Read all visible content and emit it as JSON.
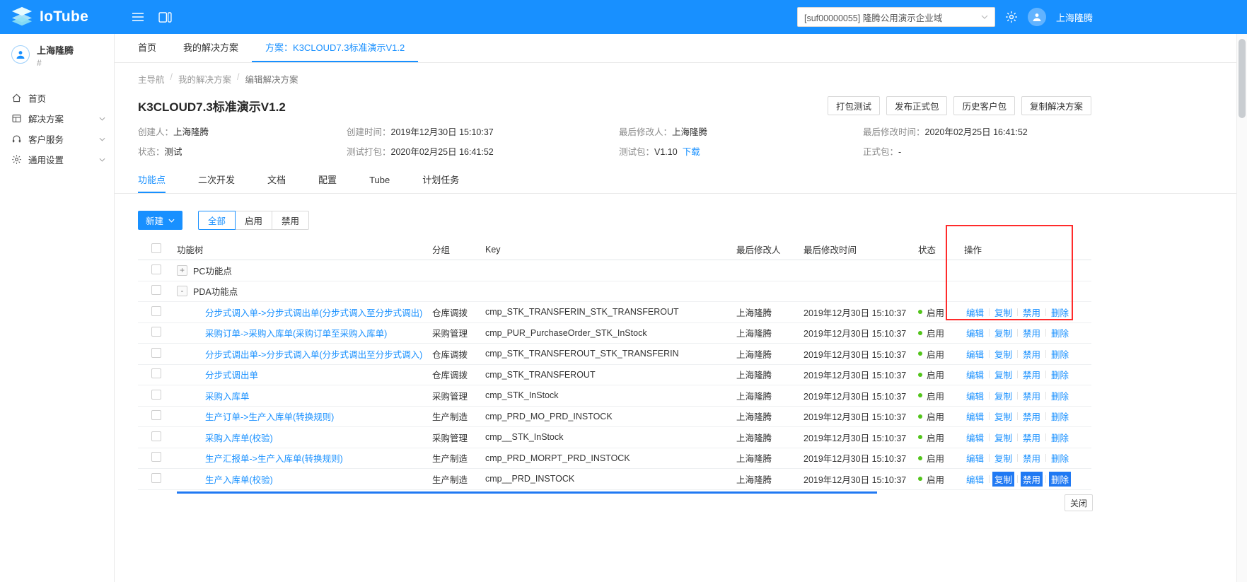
{
  "colors": {
    "accent": "#1890ff",
    "topbar": "#1890ff",
    "status_green": "#52c41a",
    "annotation_red": "#ff2b2b",
    "selection_blue": "#2079f3"
  },
  "header": {
    "logo_io": "Io",
    "logo_tube": "Tube",
    "domain_select_value": "[suf00000055] 隆腾公用演示企业域",
    "user_name": "上海隆腾"
  },
  "sidebar": {
    "user_name": "上海隆腾",
    "user_sub": "#",
    "items": [
      {
        "id": "home",
        "label": "首页",
        "icon": "home-icon",
        "expandable": false
      },
      {
        "id": "solutions",
        "label": "解决方案",
        "icon": "solutions-icon",
        "expandable": true
      },
      {
        "id": "customer-service",
        "label": "客户服务",
        "icon": "customer-service-icon",
        "expandable": true
      },
      {
        "id": "general-settings",
        "label": "通用设置",
        "icon": "settings-icon",
        "expandable": true
      }
    ]
  },
  "nav_tabs": [
    {
      "id": "home",
      "label": "首页",
      "active": false
    },
    {
      "id": "my-solutions",
      "label": "我的解决方案",
      "active": false
    },
    {
      "id": "solution",
      "label": "方案：K3CLOUD7.3标准演示V1.2",
      "active": true
    }
  ],
  "breadcrumb": [
    "主导航",
    "我的解决方案",
    "编辑解决方案"
  ],
  "page": {
    "title": "K3CLOUD7.3标准演示V1.2",
    "action_buttons": [
      {
        "id": "package-test",
        "label": "打包测试"
      },
      {
        "id": "publish-release",
        "label": "发布正式包"
      },
      {
        "id": "history-customer-packages",
        "label": "历史客户包"
      },
      {
        "id": "copy-solution",
        "label": "复制解决方案"
      }
    ],
    "meta": [
      [
        {
          "label": "创建人：",
          "value": "上海隆腾"
        },
        {
          "label": "创建时间：",
          "value": "2019年12月30日 15:10:37"
        },
        {
          "label": "最后修改人：",
          "value": "上海隆腾"
        },
        {
          "label": "最后修改时间：",
          "value": "2020年02月25日 16:41:52"
        }
      ],
      [
        {
          "label": "状态：",
          "value": "测试"
        },
        {
          "label": "测试打包：",
          "value": "2020年02月25日 16:41:52"
        },
        {
          "label": "测试包：",
          "value": "V1.10",
          "link": "下载"
        },
        {
          "label": "正式包：",
          "value": "-"
        }
      ]
    ]
  },
  "content_tabs": [
    {
      "id": "features",
      "label": "功能点",
      "active": true
    },
    {
      "id": "secondary-development",
      "label": "二次开发",
      "active": false
    },
    {
      "id": "documents",
      "label": "文档",
      "active": false
    },
    {
      "id": "config",
      "label": "配置",
      "active": false
    },
    {
      "id": "tube",
      "label": "Tube",
      "active": false
    },
    {
      "id": "scheduled-tasks",
      "label": "计划任务",
      "active": false
    }
  ],
  "toolbar": {
    "new_button": "新建",
    "filter_buttons": [
      {
        "id": "all",
        "label": "全部",
        "active": true
      },
      {
        "id": "enable",
        "label": "启用",
        "active": false
      },
      {
        "id": "disable",
        "label": "禁用",
        "active": false
      }
    ]
  },
  "table": {
    "columns": [
      "",
      "功能树",
      "分组",
      "Key",
      "最后修改人",
      "最后修改时间",
      "状态",
      "操作"
    ],
    "action_labels": [
      "编辑",
      "复制",
      "禁用",
      "删除"
    ],
    "rows": [
      {
        "type": "group",
        "expander": "+",
        "name": "PC功能点"
      },
      {
        "type": "group",
        "expander": "-",
        "name": "PDA功能点"
      },
      {
        "type": "item",
        "name": "分步式调入单->分步式调出单(分步式调入至分步式调出)",
        "group": "仓库调拨",
        "key": "cmp_STK_TRANSFERIN_STK_TRANSFEROUT",
        "modifier": "上海隆腾",
        "modified": "2019年12月30日 15:10:37",
        "status": "启用"
      },
      {
        "type": "item",
        "name": "采购订单->采购入库单(采购订单至采购入库单)",
        "group": "采购管理",
        "key": "cmp_PUR_PurchaseOrder_STK_InStock",
        "modifier": "上海隆腾",
        "modified": "2019年12月30日 15:10:37",
        "status": "启用"
      },
      {
        "type": "item",
        "name": "分步式调出单->分步式调入单(分步式调出至分步式调入)",
        "group": "仓库调拨",
        "key": "cmp_STK_TRANSFEROUT_STK_TRANSFERIN",
        "modifier": "上海隆腾",
        "modified": "2019年12月30日 15:10:37",
        "status": "启用"
      },
      {
        "type": "item",
        "name": "分步式调出单",
        "group": "仓库调拨",
        "key": "cmp_STK_TRANSFEROUT",
        "modifier": "上海隆腾",
        "modified": "2019年12月30日 15:10:37",
        "status": "启用"
      },
      {
        "type": "item",
        "name": "采购入库单",
        "group": "采购管理",
        "key": "cmp_STK_InStock",
        "modifier": "上海隆腾",
        "modified": "2019年12月30日 15:10:37",
        "status": "启用"
      },
      {
        "type": "item",
        "name": "生产订单->生产入库单(转换规则)",
        "group": "生产制造",
        "key": "cmp_PRD_MO_PRD_INSTOCK",
        "modifier": "上海隆腾",
        "modified": "2019年12月30日 15:10:37",
        "status": "启用"
      },
      {
        "type": "item",
        "name": "采购入库单(校验)",
        "group": "采购管理",
        "key": "cmp__STK_InStock",
        "modifier": "上海隆腾",
        "modified": "2019年12月30日 15:10:37",
        "status": "启用"
      },
      {
        "type": "item",
        "name": "生产汇报单->生产入库单(转换规则)",
        "group": "生产制造",
        "key": "cmp_PRD_MORPT_PRD_INSTOCK",
        "modifier": "上海隆腾",
        "modified": "2019年12月30日 15:10:37",
        "status": "启用"
      },
      {
        "type": "item",
        "name": "生产入库单(校验)",
        "group": "生产制造",
        "key": "cmp__PRD_INSTOCK",
        "modifier": "上海隆腾",
        "modified": "2019年12月30日 15:10:37",
        "status": "启用",
        "selected_actions": [
          "复制",
          "禁用",
          "删除"
        ]
      }
    ]
  },
  "annotation": {
    "highlighted_column": "操作"
  },
  "footer": {
    "close_button": "关闭"
  }
}
